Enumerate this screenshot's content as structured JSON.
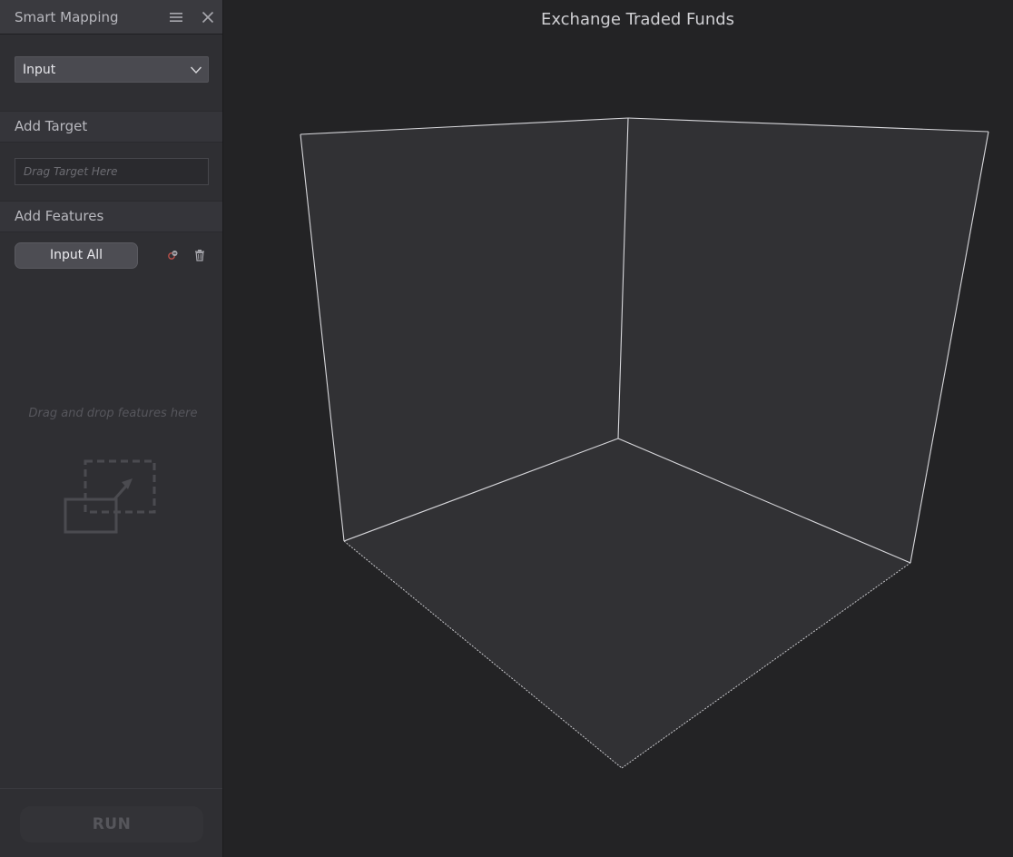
{
  "sidebar": {
    "title": "Smart Mapping",
    "header_icons": [
      "hamburger-menu-icon",
      "close-icon"
    ],
    "mode_select": {
      "value": "Input",
      "icon": "chevron-down-icon"
    },
    "target_section": {
      "label": "Add Target",
      "placeholder": "Drag Target Here"
    },
    "features_section": {
      "label": "Add Features",
      "input_all_label": "Input All",
      "icons": [
        "remove-target-icon",
        "trash-icon"
      ],
      "drop_hint": "Drag and drop features here"
    },
    "run_label": "RUN"
  },
  "viewport": {
    "title": "Exchange Traded Funds"
  },
  "colors": {
    "sidebar_bg": "#2f2f33",
    "viewport_bg": "#232325",
    "cube_face": "#313134",
    "cube_edge": "#d8d8dc"
  }
}
